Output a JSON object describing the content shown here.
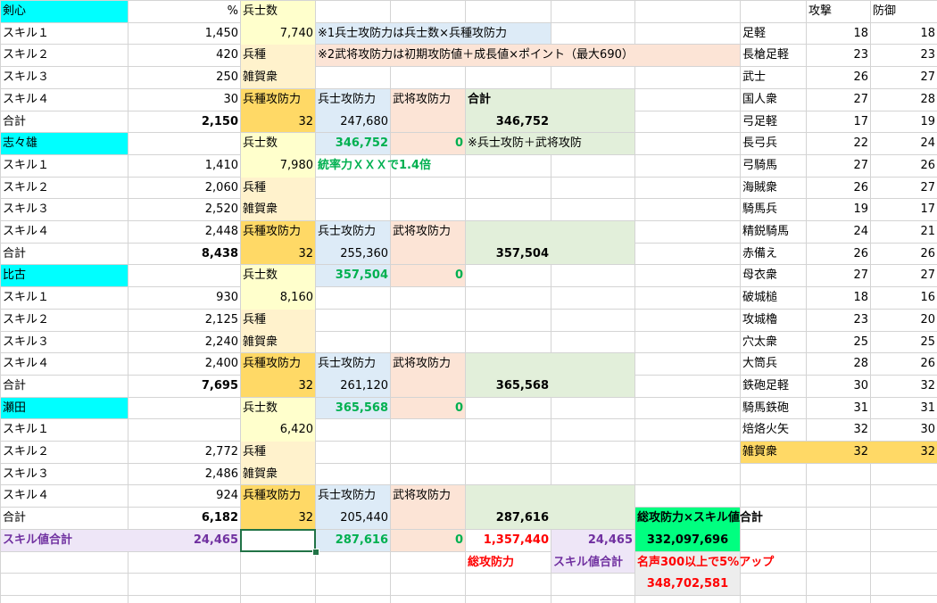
{
  "colors": {
    "cyan": "#00ffff",
    "yellow_light": "#ffffcc",
    "tan": "#fff2cc",
    "orange": "#ffd966",
    "blue_light": "#ddebf7",
    "peach": "#fce4d6",
    "green_light": "#e2efda",
    "green_bright": "#00ff80",
    "purple_light": "#eee6f7",
    "grey_light": "#ededed",
    "green_text": "#00b050",
    "red_text": "#ff0000",
    "purple_text": "#7030a0"
  },
  "sheet": {
    "header_pct": "%",
    "header_soldiers": "兵士数",
    "groups": [
      {
        "name": "剣心",
        "skills": [
          {
            "label": "スキル１",
            "value": "1,450"
          },
          {
            "label": "スキル２",
            "value": "420"
          },
          {
            "label": "スキル３",
            "value": "250"
          },
          {
            "label": "スキル４",
            "value": "30"
          }
        ],
        "total_label": "合計",
        "total": "2,150",
        "soldiers": "7,740",
        "type_label": "兵種",
        "type_value": "雑賀衆",
        "atk_labels": [
          "兵種攻防力",
          "兵士攻防力",
          "武将攻防力"
        ],
        "type_atk": "32",
        "soldier_atk": "247,680",
        "sum_label": "合計",
        "sum": "346,752"
      },
      {
        "name": "志々雄",
        "soldiers_label": "兵士数",
        "prev_total": "346,752",
        "prev_zero": "0",
        "skills": [
          {
            "label": "スキル１",
            "value": "1,410"
          },
          {
            "label": "スキル２",
            "value": "2,060"
          },
          {
            "label": "スキル３",
            "value": "2,520"
          },
          {
            "label": "スキル４",
            "value": "2,448"
          }
        ],
        "total_label": "合計",
        "total": "8,438",
        "soldiers": "7,980",
        "type_label": "兵種",
        "type_value": "雑賀衆",
        "atk_labels": [
          "兵種攻防力",
          "兵士攻防力",
          "武将攻防力"
        ],
        "type_atk": "32",
        "soldier_atk": "255,360",
        "sum": "357,504"
      },
      {
        "name": "比古",
        "soldiers_label": "兵士数",
        "prev_total": "357,504",
        "prev_zero": "0",
        "skills": [
          {
            "label": "スキル１",
            "value": "930"
          },
          {
            "label": "スキル２",
            "value": "2,125"
          },
          {
            "label": "スキル３",
            "value": "2,240"
          },
          {
            "label": "スキル４",
            "value": "2,400"
          }
        ],
        "total_label": "合計",
        "total": "7,695",
        "soldiers": "8,160",
        "type_label": "兵種",
        "type_value": "雑賀衆",
        "atk_labels": [
          "兵種攻防力",
          "兵士攻防力",
          "武将攻防力"
        ],
        "type_atk": "32",
        "soldier_atk": "261,120",
        "sum": "365,568"
      },
      {
        "name": "瀬田",
        "soldiers_label": "兵士数",
        "prev_total": "365,568",
        "prev_zero": "0",
        "skills": [
          {
            "label": "スキル１",
            "value": ""
          },
          {
            "label": "スキル２",
            "value": "2,772"
          },
          {
            "label": "スキル３",
            "value": "2,486"
          },
          {
            "label": "スキル４",
            "value": "924"
          }
        ],
        "total_label": "合計",
        "total": "6,182",
        "soldiers": "6,420",
        "type_label": "兵種",
        "type_value": "雑賀衆",
        "atk_labels": [
          "兵種攻防力",
          "兵士攻防力",
          "武将攻防力"
        ],
        "type_atk": "32",
        "soldier_atk": "205,440",
        "sum": "287,616"
      }
    ],
    "notes": {
      "n1": "※1兵士攻防力は兵士数×兵種攻防力",
      "n2": "※2武将攻防力は初期攻防値＋成長値×ポイント（最大690）",
      "n3": "※兵士攻防＋武将攻防",
      "leadership": "統率力ＸＸＸで1.4倍"
    },
    "summary": {
      "skill_total_label": "スキル値合計",
      "skill_total": "24,465",
      "last_total": "287,616",
      "last_zero": "0",
      "grand_total": "1,357,440",
      "grand_total_label": "総攻防力",
      "skill_total_2": "24,465",
      "skill_total_label_2": "スキル値合計",
      "product_label": "総攻防力×スキル値合計",
      "product": "332,097,696",
      "fame_label": "名声300以上で5%アップ",
      "fame_value": "348,702,581"
    },
    "units_header": {
      "atk": "攻撃",
      "def": "防御"
    },
    "units": [
      {
        "name": "足軽",
        "atk": "18",
        "def": "18"
      },
      {
        "name": "長槍足軽",
        "atk": "23",
        "def": "23"
      },
      {
        "name": "武士",
        "atk": "26",
        "def": "27"
      },
      {
        "name": "国人衆",
        "atk": "27",
        "def": "28"
      },
      {
        "name": "弓足軽",
        "atk": "17",
        "def": "19"
      },
      {
        "name": "長弓兵",
        "atk": "22",
        "def": "24"
      },
      {
        "name": "弓騎馬",
        "atk": "27",
        "def": "26"
      },
      {
        "name": "海賊衆",
        "atk": "26",
        "def": "27"
      },
      {
        "name": "騎馬兵",
        "atk": "19",
        "def": "17"
      },
      {
        "name": "精鋭騎馬",
        "atk": "24",
        "def": "21"
      },
      {
        "name": "赤備え",
        "atk": "26",
        "def": "26"
      },
      {
        "name": "母衣衆",
        "atk": "27",
        "def": "27"
      },
      {
        "name": "破城槌",
        "atk": "18",
        "def": "16"
      },
      {
        "name": "攻城櫓",
        "atk": "23",
        "def": "20"
      },
      {
        "name": "穴太衆",
        "atk": "25",
        "def": "25"
      },
      {
        "name": "大筒兵",
        "atk": "28",
        "def": "26"
      },
      {
        "name": "鉄砲足軽",
        "atk": "30",
        "def": "32"
      },
      {
        "name": "騎馬鉄砲",
        "atk": "31",
        "def": "31"
      },
      {
        "name": "焙烙火矢",
        "atk": "32",
        "def": "30"
      },
      {
        "name": "雑賀衆",
        "atk": "32",
        "def": "32"
      }
    ]
  }
}
